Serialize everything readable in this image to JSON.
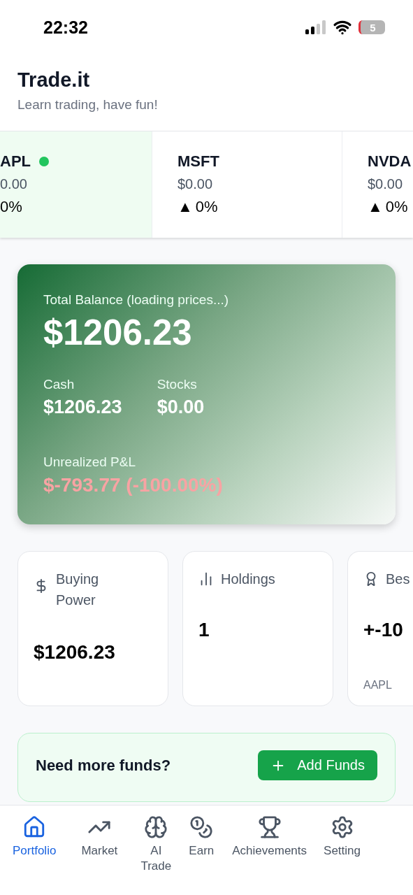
{
  "status_bar": {
    "time": "22:32",
    "battery": "5"
  },
  "header": {
    "title": "Trade.it",
    "subtitle": "Learn trading, have fun!"
  },
  "tickers": [
    {
      "symbol": "APL",
      "price": "0.00",
      "change": "0%",
      "selected": true,
      "live": true
    },
    {
      "symbol": "MSFT",
      "price": "$0.00",
      "arrow": "▲",
      "change": "0%",
      "selected": false,
      "live": false
    },
    {
      "symbol": "NVDA",
      "price": "$0.00",
      "arrow": "▲",
      "change": "0%",
      "selected": false,
      "live": false
    }
  ],
  "balance_card": {
    "label": "Total Balance (loading prices...)",
    "total": "$1206.23",
    "split": [
      {
        "label": "Cash",
        "value": "$1206.23"
      },
      {
        "label": "Stocks",
        "value": "$0.00"
      }
    ],
    "pnl_label": "Unrealized P&L",
    "pnl_value": "$-793.77 (-100.00%)",
    "pnl_negative": true
  },
  "stats": [
    {
      "kind": "dollar",
      "label": "Buying Power",
      "value": "$1206.23"
    },
    {
      "kind": "bars",
      "label": "Holdings",
      "value": "1"
    },
    {
      "kind": "award",
      "label": "Bes",
      "value": "+-10",
      "note": "AAPL"
    }
  ],
  "funds_banner": {
    "text": "Need more funds?",
    "button": "Add Funds"
  },
  "nav": [
    {
      "kind": "home",
      "label": "Portfolio",
      "selected": true
    },
    {
      "kind": "market",
      "label": "Market",
      "selected": false
    },
    {
      "kind": "brain",
      "label": "AI Trade",
      "selected": false
    },
    {
      "kind": "coins",
      "label": "Earn",
      "selected": false
    },
    {
      "kind": "trophy",
      "label": "Achievements",
      "selected": false
    },
    {
      "kind": "settings",
      "label": "Setting",
      "selected": false
    }
  ]
}
